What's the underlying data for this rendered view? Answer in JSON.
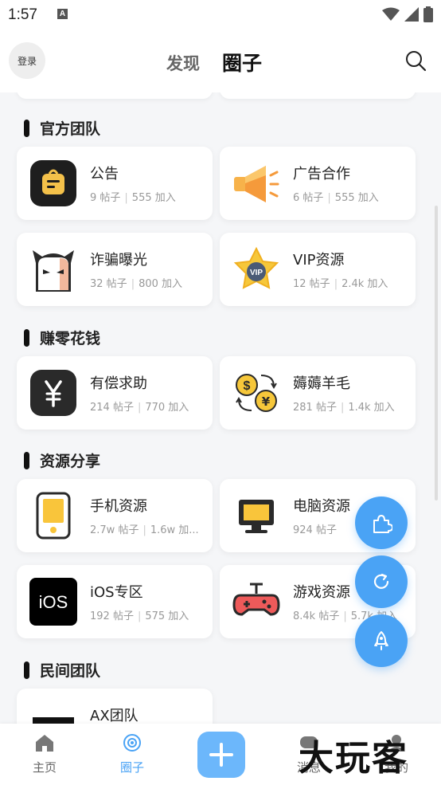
{
  "status_bar": {
    "time": "1:57",
    "notice_glyph": "A"
  },
  "header": {
    "login_label": "登录",
    "tabs": [
      {
        "label": "发现",
        "active": false
      },
      {
        "label": "圈子",
        "active": true
      }
    ],
    "search_icon": "search-icon"
  },
  "sections": [
    {
      "title": "官方团队",
      "cards": [
        {
          "name": "公告",
          "posts": "9 帖子",
          "joins": "555 加入",
          "icon": "announcement-icon"
        },
        {
          "name": "广告合作",
          "posts": "6 帖子",
          "joins": "555 加入",
          "icon": "megaphone-icon"
        },
        {
          "name": "诈骗曝光",
          "posts": "32 帖子",
          "joins": "800 加入",
          "icon": "ghost-icon"
        },
        {
          "name": "VIP资源",
          "posts": "12 帖子",
          "joins": "2.4k 加入",
          "icon": "vip-star-icon"
        }
      ]
    },
    {
      "title": "赚零花钱",
      "cards": [
        {
          "name": "有偿求助",
          "posts": "214 帖子",
          "joins": "770 加入",
          "icon": "yen-icon"
        },
        {
          "name": "薅薅羊毛",
          "posts": "281 帖子",
          "joins": "1.4k 加入",
          "icon": "coin-exchange-icon"
        }
      ]
    },
    {
      "title": "资源分享",
      "cards": [
        {
          "name": "手机资源",
          "posts": "2.7w 帖子",
          "joins": "1.6w 加...",
          "icon": "phone-icon"
        },
        {
          "name": "电脑资源",
          "posts": "924 帖子",
          "joins": "",
          "icon": "computer-icon"
        },
        {
          "name": "iOS专区",
          "posts": "192 帖子",
          "joins": "575 加入",
          "icon": "ios-icon",
          "icon_text": "iOS"
        },
        {
          "name": "游戏资源",
          "posts": "8.4k 帖子",
          "joins": "5.7k 加入",
          "icon": "gamepad-icon"
        }
      ]
    },
    {
      "title": "民间团队",
      "cards": [
        {
          "name": "AX团队",
          "posts": "",
          "joins": "",
          "icon": "ax-team-icon"
        }
      ]
    }
  ],
  "fabs": [
    {
      "icon": "puzzle-icon"
    },
    {
      "icon": "refresh-icon"
    },
    {
      "icon": "rocket-icon"
    }
  ],
  "bottom_nav": {
    "items": [
      {
        "label": "主页",
        "icon": "home-icon",
        "active": false
      },
      {
        "label": "圈子",
        "icon": "circle-target-icon",
        "active": true
      },
      {
        "label": "消息",
        "icon": "message-icon",
        "active": false
      },
      {
        "label": "我的",
        "icon": "profile-icon",
        "active": false
      }
    ],
    "add_icon": "plus-icon"
  },
  "watermark": "大玩客",
  "colors": {
    "accent": "#4aa3f5",
    "active_tab": "#4aa3f5",
    "section_bar": "#111111"
  }
}
